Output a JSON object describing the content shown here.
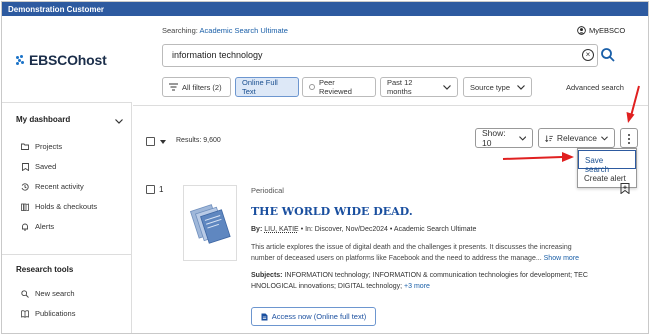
{
  "topbar": {
    "title": "Demonstration Customer"
  },
  "brand": {
    "name": "EBSCOhost"
  },
  "header": {
    "searching_label": "Searching:",
    "database": "Academic Search Ultimate",
    "account": "MyEBSCO"
  },
  "search": {
    "value": "information technology"
  },
  "filters": {
    "all_filters": "All filters (2)",
    "online_full_text": "Online Full Text",
    "peer_reviewed": "Peer Reviewed",
    "date_range": "Past 12 months",
    "source_type": "Source type",
    "advanced": "Advanced search"
  },
  "sidebar": {
    "dashboard_heading": "My dashboard",
    "dashboard_items": [
      {
        "label": "Projects",
        "icon": "folder-icon"
      },
      {
        "label": "Saved",
        "icon": "save-icon"
      },
      {
        "label": "Recent activity",
        "icon": "history-icon"
      },
      {
        "label": "Holds & checkouts",
        "icon": "books-icon"
      },
      {
        "label": "Alerts",
        "icon": "bell-icon"
      }
    ],
    "tools_heading": "Research tools",
    "tools_items": [
      {
        "label": "New search",
        "icon": "search-icon"
      },
      {
        "label": "Publications",
        "icon": "publications-icon"
      }
    ]
  },
  "results": {
    "count_text": "Results: 9,600",
    "show_label": "Show: 10",
    "sort_label": "Relevance"
  },
  "menu": {
    "save_search": "Save search",
    "create_alert": "Create alert"
  },
  "record": {
    "number": "1",
    "type": "Periodical",
    "title": "THE WORLD WIDE DEAD.",
    "by_label": "By:",
    "author": "LIU, KATIE",
    "source": "• In: Discover, Nov/Dec2024 • Academic Search Ultimate",
    "abstract_line1": "This article explores the issue of digital death and the challenges it presents. It discusses the increasing",
    "abstract_line2": "number of deceased users on platforms like Facebook and the need to address the manage...",
    "show_more": "Show more",
    "subjects_label": "Subjects:",
    "subjects_line1": "INFORMATION technology; INFORMATION & communication technologies for development; TEC",
    "subjects_line2": "HNOLOGICAL innovations; DIGITAL technology;",
    "subjects_more": "+3 more",
    "access_label": "Access now (Online full text)"
  },
  "colors": {
    "topbar": "#2d5aa0",
    "accent": "#1a4f9f",
    "annotation": "#e02020"
  }
}
